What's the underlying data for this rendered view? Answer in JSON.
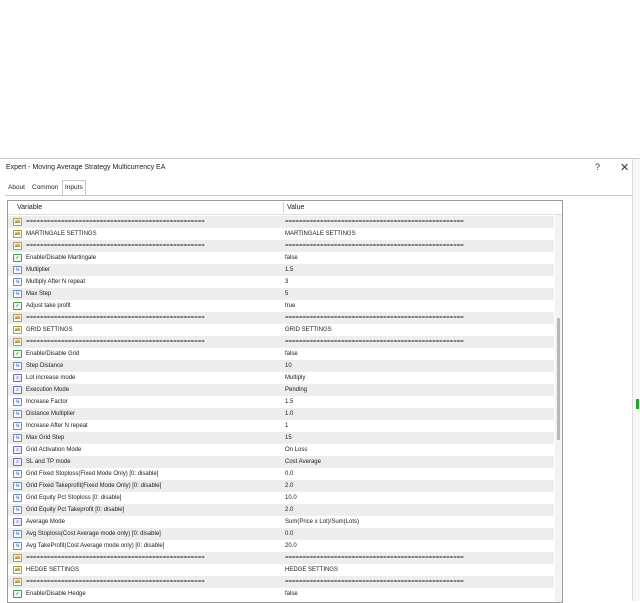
{
  "window": {
    "title": "Expert - Moving Average Strategy Multicurrency EA",
    "help_glyph": "?",
    "close_glyph": "✕"
  },
  "tabs": [
    {
      "label": "About"
    },
    {
      "label": "Common"
    },
    {
      "label": "Inputs"
    }
  ],
  "grid": {
    "col_variable": "Variable",
    "col_value": "Value",
    "rows": [
      {
        "type": "str",
        "variable": "===================================================",
        "value": "==================================================="
      },
      {
        "type": "str",
        "variable": "MARTINGALE SETTINGS",
        "value": "MARTINGALE SETTINGS"
      },
      {
        "type": "str",
        "variable": "===================================================",
        "value": "==================================================="
      },
      {
        "type": "bool",
        "variable": "Enable/Disable Martingale",
        "value": "false"
      },
      {
        "type": "num",
        "variable": "Multiplier",
        "value": "1.5"
      },
      {
        "type": "num",
        "variable": "Multiply After N repeat",
        "value": "3"
      },
      {
        "type": "num",
        "variable": "Max Step",
        "value": "5"
      },
      {
        "type": "bool",
        "variable": "Adjust take profit",
        "value": "true"
      },
      {
        "type": "str",
        "variable": "===================================================",
        "value": "==================================================="
      },
      {
        "type": "str",
        "variable": "GRID SETTINGS",
        "value": "GRID SETTINGS"
      },
      {
        "type": "str",
        "variable": "===================================================",
        "value": "==================================================="
      },
      {
        "type": "bool",
        "variable": "Enable/Disable Grid",
        "value": "false"
      },
      {
        "type": "num",
        "variable": "Step Distance",
        "value": "10"
      },
      {
        "type": "enum",
        "variable": "Lot increase mode",
        "value": "Multiply"
      },
      {
        "type": "enum",
        "variable": "Execution Mode",
        "value": "Pending"
      },
      {
        "type": "num",
        "variable": "Increase Factor",
        "value": "1.5"
      },
      {
        "type": "num",
        "variable": "Distance Multiplier",
        "value": "1.0"
      },
      {
        "type": "num",
        "variable": "Increase After N repeat",
        "value": "1"
      },
      {
        "type": "num",
        "variable": "Max Grid Step",
        "value": "15"
      },
      {
        "type": "enum",
        "variable": "Grid Activation Mode",
        "value": "On Loss"
      },
      {
        "type": "enum",
        "variable": "SL and TP mode",
        "value": "Cost Average"
      },
      {
        "type": "num",
        "variable": "Grid Fixed Stoploss(Fixed Mode Only) [0: disable]",
        "value": "0.0"
      },
      {
        "type": "num",
        "variable": "Grid Fixed Takeprofit(Fixed Mode Only) [0: disable]",
        "value": "2.0"
      },
      {
        "type": "num",
        "variable": "Grid Equity Pct Stoploss [0: disable]",
        "value": "10.0"
      },
      {
        "type": "num",
        "variable": "Grid Equity Pct Takeprofit [0: disable]",
        "value": "2.0"
      },
      {
        "type": "enum",
        "variable": "Average Mode",
        "value": "Sum(Price x Lot)/Sum(Lots)"
      },
      {
        "type": "num",
        "variable": "Avg Stoploss(Cost Average mode only) [0: disable]",
        "value": "0.0"
      },
      {
        "type": "num",
        "variable": "Avg TakeProfit(Cost Average mode only) [0: disable]",
        "value": "20.0"
      },
      {
        "type": "str",
        "variable": "===================================================",
        "value": "==================================================="
      },
      {
        "type": "str",
        "variable": "HEDGE SETTINGS",
        "value": "HEDGE SETTINGS"
      },
      {
        "type": "str",
        "variable": "===================================================",
        "value": "==================================================="
      },
      {
        "type": "bool",
        "variable": "Enable/Disable Hedge",
        "value": "false"
      }
    ]
  },
  "icon_labels": {
    "str": "ab",
    "bool": "✓",
    "num": "½",
    "enum": "≡"
  },
  "colors": {
    "alt_row": "#ededed",
    "border": "#9a9a9a",
    "accent_green": "#2ea02e"
  }
}
